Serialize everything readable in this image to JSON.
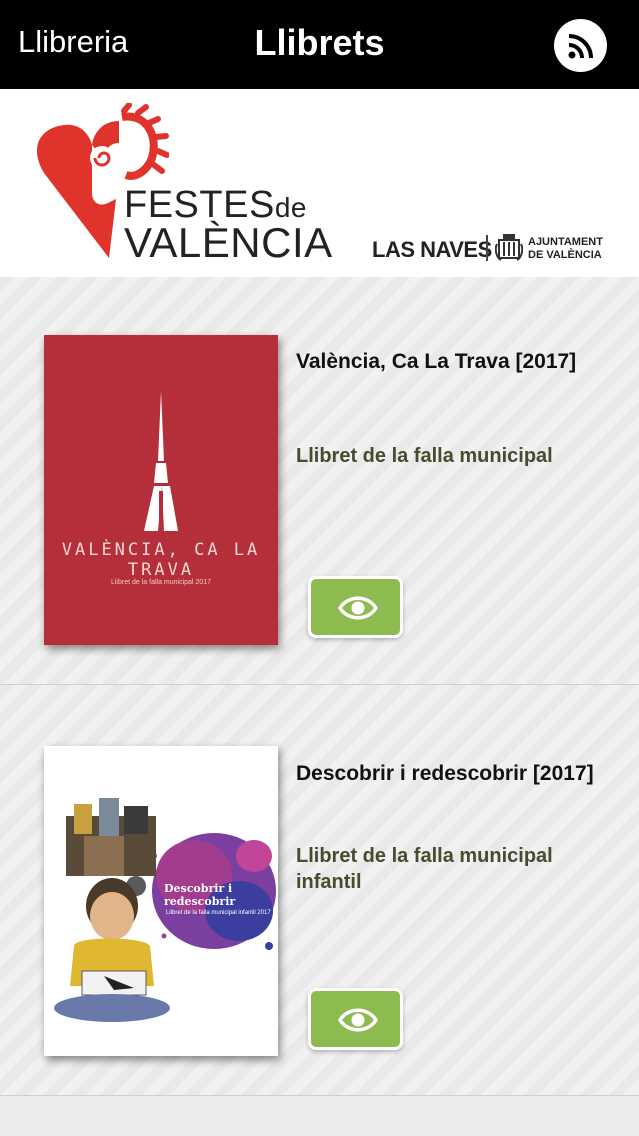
{
  "navbar": {
    "back_label": "Llibreria",
    "title": "Llibrets",
    "rss_icon": "rss-icon"
  },
  "banner": {
    "logo_line1": "FESTES",
    "logo_line1_small": "de",
    "logo_line2": "VALÈNCIA",
    "partner_1": "LAS NAVES",
    "partner_2_line1": "AJUNTAMENT",
    "partner_2_line2": "DE VALÈNCIA"
  },
  "items": [
    {
      "title": "València, Ca La Trava [2017]",
      "subtitle": "Llibret de la falla municipal",
      "cover_title": "VALÈNCIA, CA LA TRAVA",
      "cover_subtitle": "Llibret de la falla municipal 2017",
      "view_icon": "eye-icon"
    },
    {
      "title": "Descobrir i redescobrir [2017]",
      "subtitle": "Llibret de la falla municipal infantil",
      "cover_title": "Descobrir i redescobrir",
      "cover_subtitle": "Llibret de la falla municipal infantil 2017",
      "view_icon": "eye-icon"
    }
  ],
  "colors": {
    "navbar_bg": "#000000",
    "accent_red": "#e0332b",
    "button_green": "#8dbb50",
    "subtitle_olive": "#4a4a2e",
    "cover1_red": "#b52f3a"
  }
}
